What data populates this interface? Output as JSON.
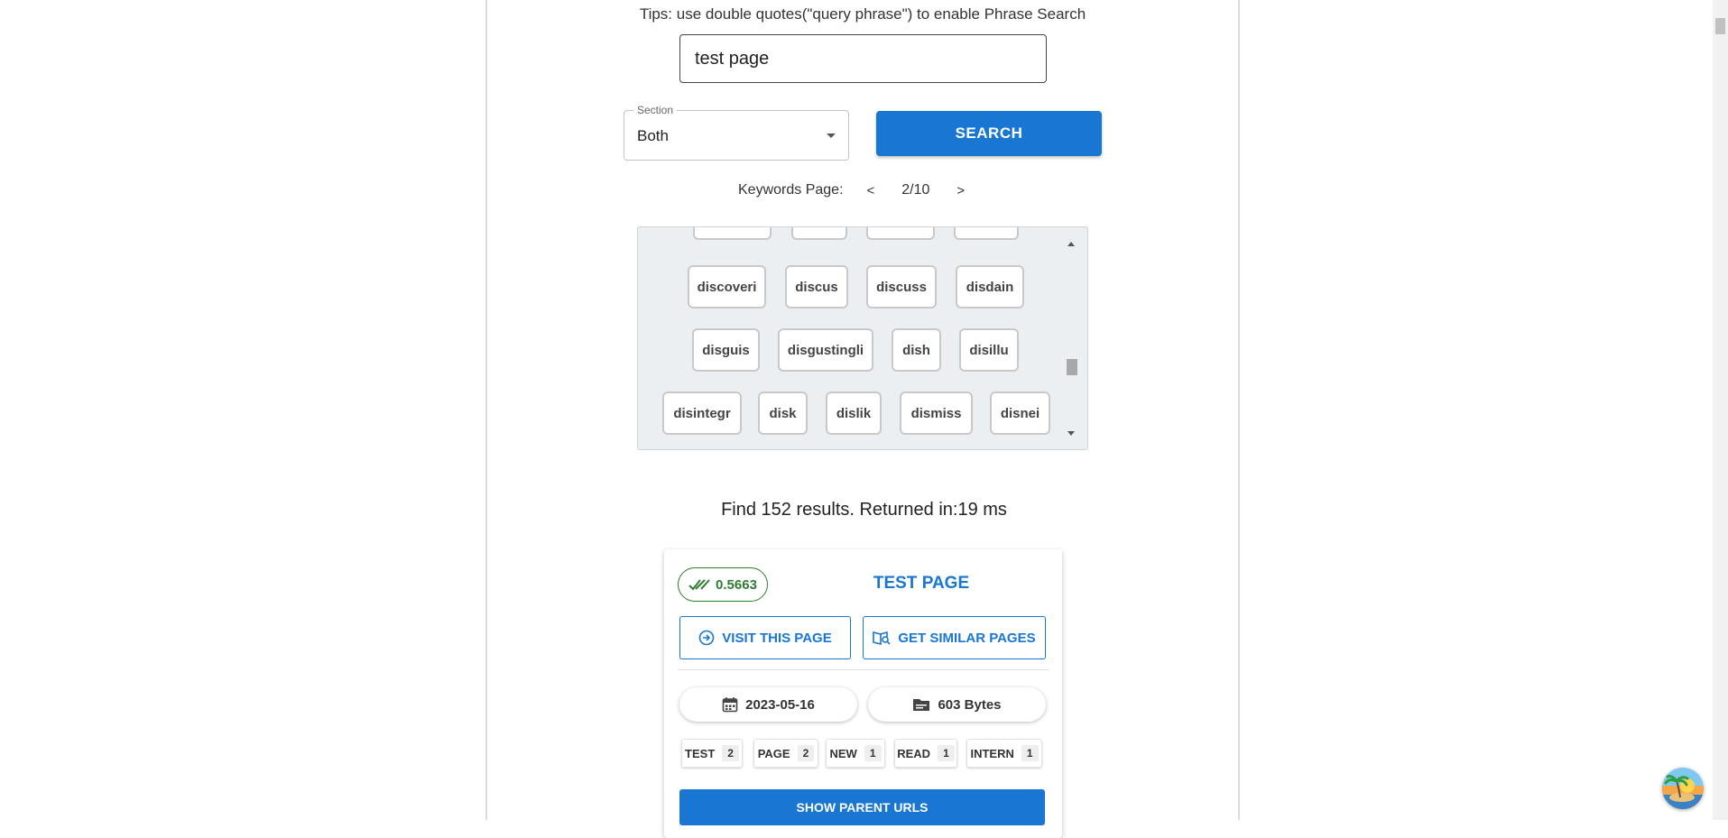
{
  "search": {
    "tips": "Tips: use double quotes(\"query phrase\") to enable Phrase Search",
    "query_value": "test page",
    "section_label": "Section",
    "section_value": "Both",
    "search_label": "SEARCH"
  },
  "keywords": {
    "pager_label": "Keywords Page:",
    "prev": "<",
    "page": "2/10",
    "next": ">",
    "chips": [
      "discoveri",
      "discus",
      "discuss",
      "disdain",
      "disguis",
      "disgustingli",
      "dish",
      "disillu",
      "disintegr",
      "disk",
      "dislik",
      "dismiss",
      "disnei"
    ]
  },
  "results": {
    "summary": "Find 152 results. Returned in:19 ms",
    "card": {
      "score": "0.5663",
      "title": "TEST PAGE",
      "visit_label": "VISIT THIS PAGE",
      "similar_label": "GET SIMILAR PAGES",
      "date": "2023-05-16",
      "size": "603 Bytes",
      "terms": [
        {
          "term": "TEST",
          "count": "2"
        },
        {
          "term": "PAGE",
          "count": "2"
        },
        {
          "term": "NEW",
          "count": "1"
        },
        {
          "term": "READ",
          "count": "1"
        },
        {
          "term": "INTERN",
          "count": "1"
        }
      ],
      "parent_label": "SHOW PARENT URLS"
    }
  },
  "colors": {
    "primary": "#1976d2",
    "score_green": "#2e7d32",
    "keyword_box_bg": "#eceff1"
  }
}
